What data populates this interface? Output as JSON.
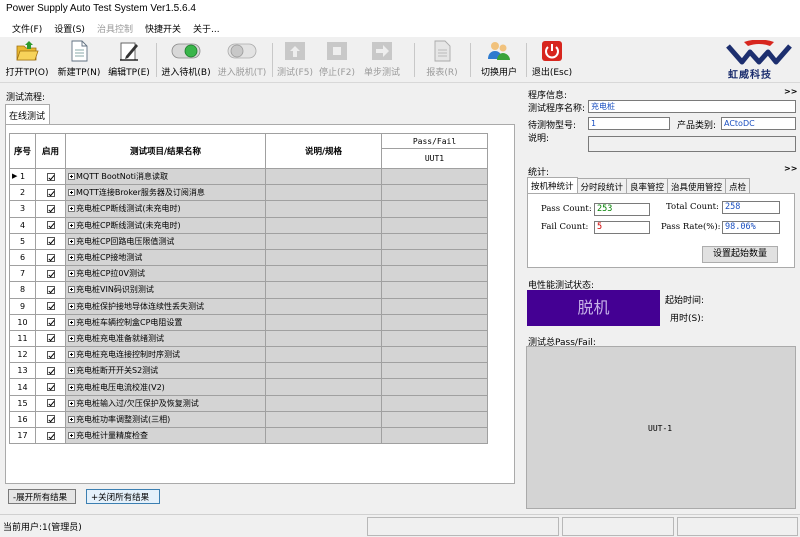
{
  "window": {
    "title": "Power Supply Auto Test System Ver1.5.6.4"
  },
  "menu": [
    {
      "label": "文件(F)",
      "disabled": false
    },
    {
      "label": "设置(S)",
      "disabled": false
    },
    {
      "label": "治具控制",
      "disabled": true
    },
    {
      "label": "快捷开关",
      "disabled": false
    },
    {
      "label": "关于...",
      "disabled": false
    }
  ],
  "toolbar": {
    "open_tp": "打开TP(O)",
    "new_tp": "新建TP(N)",
    "edit_tp": "编辑TP(E)",
    "enter_standby": "进入待机(B)",
    "enter_offline": "进入脱机(T)",
    "test": "测试(F5)",
    "stop": "停止(F2)",
    "single_step": "单步测试",
    "report": "报表(R)",
    "switch_user": "切换用户",
    "exit": "退出(Esc)"
  },
  "logo": {
    "brand": "虹威科技"
  },
  "flow": {
    "section_label": "测试流程:",
    "tab_label": "在线测试",
    "headers": {
      "seq": "序号",
      "enable": "启用",
      "item": "测试项目/结果名称",
      "desc": "说明/规格",
      "passfail": "Pass/Fail",
      "uut": "UUT1"
    },
    "rows": [
      {
        "seq": "1",
        "name": "MQTT BootNoti消息读取"
      },
      {
        "seq": "2",
        "name": "MQTT连接Broker服务器及订阅消息"
      },
      {
        "seq": "3",
        "name": "充电桩CP断线测试(未充电时)"
      },
      {
        "seq": "4",
        "name": "充电桩CP断线测试(未充电时)"
      },
      {
        "seq": "5",
        "name": "充电桩CP回路电压限值测试"
      },
      {
        "seq": "6",
        "name": "充电桩CP接地测试"
      },
      {
        "seq": "7",
        "name": "充电桩CP拉0V测试"
      },
      {
        "seq": "8",
        "name": "充电桩VIN码识别测试"
      },
      {
        "seq": "9",
        "name": "充电桩保护接地导体连续性丢失测试"
      },
      {
        "seq": "10",
        "name": "充电桩车辆控制盒CP电阻设置"
      },
      {
        "seq": "11",
        "name": "充电桩充电准备就绪测试"
      },
      {
        "seq": "12",
        "name": "充电桩充电连接控制时序测试"
      },
      {
        "seq": "13",
        "name": "充电桩断开开关S2测试"
      },
      {
        "seq": "14",
        "name": "充电桩电压电流校准(V2)"
      },
      {
        "seq": "15",
        "name": "充电桩输入过/欠压保护及恢复测试"
      },
      {
        "seq": "16",
        "name": "充电桩功率调整测试(三相)"
      },
      {
        "seq": "17",
        "name": "充电桩计量精度检查"
      }
    ],
    "expand_all": "-展开所有结果",
    "collapse_all": "+关闭所有结果"
  },
  "program_info": {
    "section_label": "程序信息:",
    "name_label": "测试程序名称:",
    "name_value": "充电桩",
    "part_label": "待测物型号:",
    "part_value": "1",
    "category_label": "产品类别:",
    "category_value": "ACtoDC",
    "desc_label": "说明:",
    "desc_value": ""
  },
  "stats": {
    "section_label": "统计:",
    "tabs": [
      "按机种统计",
      "分时段统计",
      "良率管控",
      "治具使用管控",
      "点检"
    ],
    "pass_count_label": "Pass Count:",
    "pass_count": "253",
    "total_count_label": "Total Count:",
    "total_count": "258",
    "fail_count_label": "Fail Count:",
    "fail_count": "5",
    "pass_rate_label": "Pass Rate(%):",
    "pass_rate": "98.06%",
    "set_start_button": "设置起始数量"
  },
  "electrical": {
    "section_label": "电性能测试状态:",
    "state": "脱机",
    "start_time_label": "起始时间:",
    "elapsed_label": "用时(S):"
  },
  "total_passfail": {
    "section_label": "测试总Pass/Fail:",
    "uut_label": "UUT-1"
  },
  "statusbar": {
    "current_user": "当前用户:1(管理员)"
  },
  "colors": {
    "offline_bg": "#440093",
    "pass_green": "#008000",
    "fail_red": "#d00000",
    "link_blue": "#1a4fc0"
  }
}
